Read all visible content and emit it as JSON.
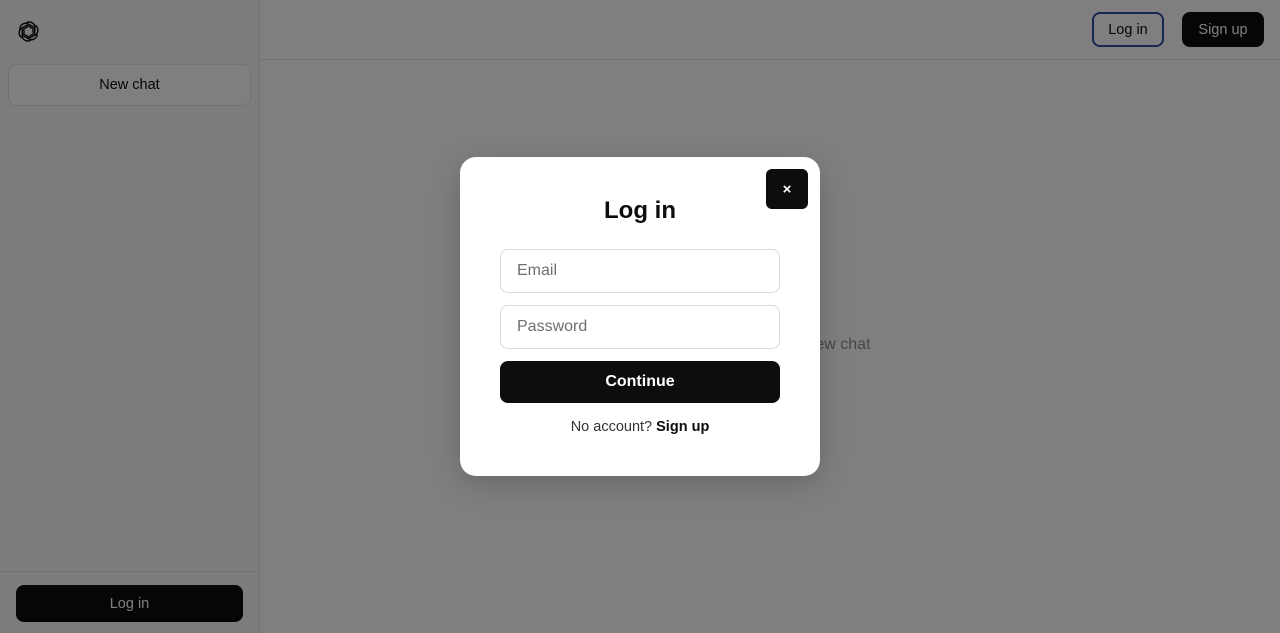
{
  "sidebar": {
    "logo_icon": "openai-logo-icon",
    "new_chat_label": "New chat",
    "login_label": "Log in"
  },
  "topbar": {
    "login_label": "Log in",
    "signup_label": "Sign up"
  },
  "main": {
    "hint_text": "Log in to start your new chat"
  },
  "modal": {
    "close_label": "×",
    "title": "Log in",
    "email_placeholder": "Email",
    "password_placeholder": "Password",
    "continue_label": "Continue",
    "no_account_text": "No account?",
    "signup_link": "Sign up"
  },
  "colors": {
    "primary": "#0d0d0d",
    "focus_ring": "#2a4fa0",
    "overlay": "rgba(0,0,0,0.5)"
  }
}
